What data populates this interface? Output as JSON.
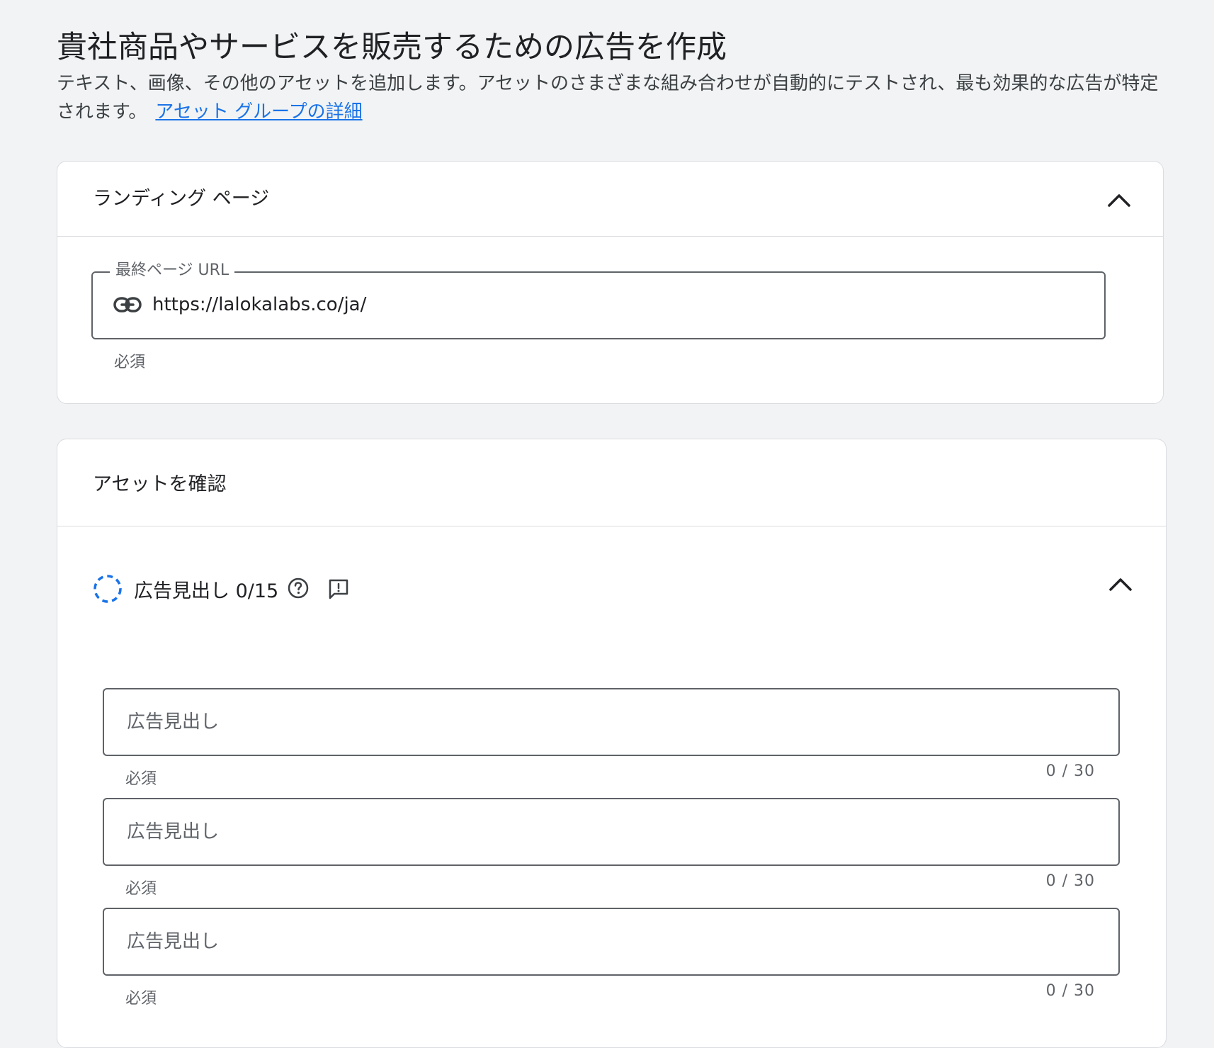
{
  "page": {
    "title": "貴社商品やサービスを販売するための広告を作成",
    "description": "テキスト、画像、その他のアセットを追加します。アセットのさまざまな組み合わせが自動的にテストされ、最も効果的な広告が特定されます。",
    "learn_more_link": "アセット グループの詳細"
  },
  "landing_page": {
    "title": "ランディング ページ",
    "collapse_icon": "chevron-up-icon",
    "final_url": {
      "label": "最終ページ URL",
      "icon": "link-icon",
      "value": "https://lalokalabs.co/ja/",
      "helper": "必須"
    }
  },
  "assets": {
    "title": "アセットを確認",
    "headlines": {
      "status_icon": "progress-ring-icon",
      "title": "広告見出し 0/15",
      "help_icon": "help-circle-icon",
      "feedback_icon": "feedback-icon",
      "collapse_icon": "chevron-up-icon",
      "accent_color": "#1a73e8",
      "fields": [
        {
          "placeholder": "広告見出し",
          "helper": "必須",
          "counter": "0 / 30"
        },
        {
          "placeholder": "広告見出し",
          "helper": "必須",
          "counter": "0 / 30"
        },
        {
          "placeholder": "広告見出し",
          "helper": "必須",
          "counter": "0 / 30"
        }
      ]
    }
  }
}
